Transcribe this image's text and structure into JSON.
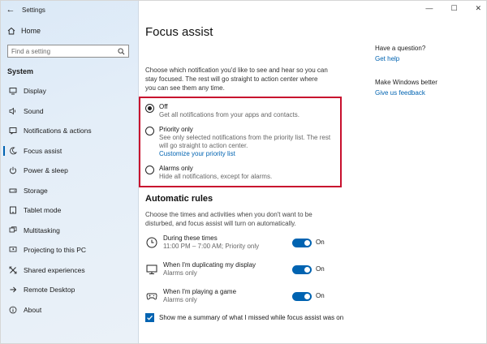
{
  "window": {
    "app_title": "Settings",
    "controls": {
      "minimize": "—",
      "maximize": "☐",
      "close": "✕"
    }
  },
  "sidebar": {
    "home_label": "Home",
    "search_placeholder": "Find a setting",
    "section_label": "System",
    "items": [
      {
        "label": "Display",
        "icon": "display-icon"
      },
      {
        "label": "Sound",
        "icon": "sound-icon"
      },
      {
        "label": "Notifications & actions",
        "icon": "notifications-icon"
      },
      {
        "label": "Focus assist",
        "icon": "moon-icon",
        "active": true
      },
      {
        "label": "Power & sleep",
        "icon": "power-icon"
      },
      {
        "label": "Storage",
        "icon": "storage-icon"
      },
      {
        "label": "Tablet mode",
        "icon": "tablet-icon"
      },
      {
        "label": "Multitasking",
        "icon": "multitasking-icon"
      },
      {
        "label": "Projecting to this PC",
        "icon": "projecting-icon"
      },
      {
        "label": "Shared experiences",
        "icon": "shared-icon"
      },
      {
        "label": "Remote Desktop",
        "icon": "remote-icon"
      },
      {
        "label": "About",
        "icon": "info-icon"
      }
    ]
  },
  "main": {
    "title": "Focus assist",
    "intro": "Choose which notification you'd like to see and hear so you can stay focused. The rest will go straight to action center where you can see them any time.",
    "options": [
      {
        "title": "Off",
        "desc": "Get all notifications from your apps and contacts.",
        "selected": true
      },
      {
        "title": "Priority only",
        "desc": "See only selected notifications from the priority list. The rest will go straight to action center.",
        "link": "Customize your priority list",
        "selected": false
      },
      {
        "title": "Alarms only",
        "desc": "Hide all notifications, except for alarms.",
        "selected": false
      }
    ],
    "rules_title": "Automatic rules",
    "rules_desc": "Choose the times and activities when you don't want to be disturbed, and focus assist will turn on automatically.",
    "rules": [
      {
        "title": "During these times",
        "sub": "11:00 PM – 7:00 AM; Priority only",
        "state": "On",
        "icon": "clock-icon"
      },
      {
        "title": "When I'm duplicating my display",
        "sub": "Alarms only",
        "state": "On",
        "icon": "monitor-icon"
      },
      {
        "title": "When I'm playing a game",
        "sub": "Alarms only",
        "state": "On",
        "icon": "gamepad-icon"
      }
    ],
    "summary_label": "Show me a summary of what I missed while focus assist was on"
  },
  "help": {
    "question": "Have a question?",
    "get_help": "Get help",
    "better": "Make Windows better",
    "feedback": "Give us feedback"
  },
  "colors": {
    "accent": "#0063b1",
    "highlight_border": "#c8102e"
  }
}
